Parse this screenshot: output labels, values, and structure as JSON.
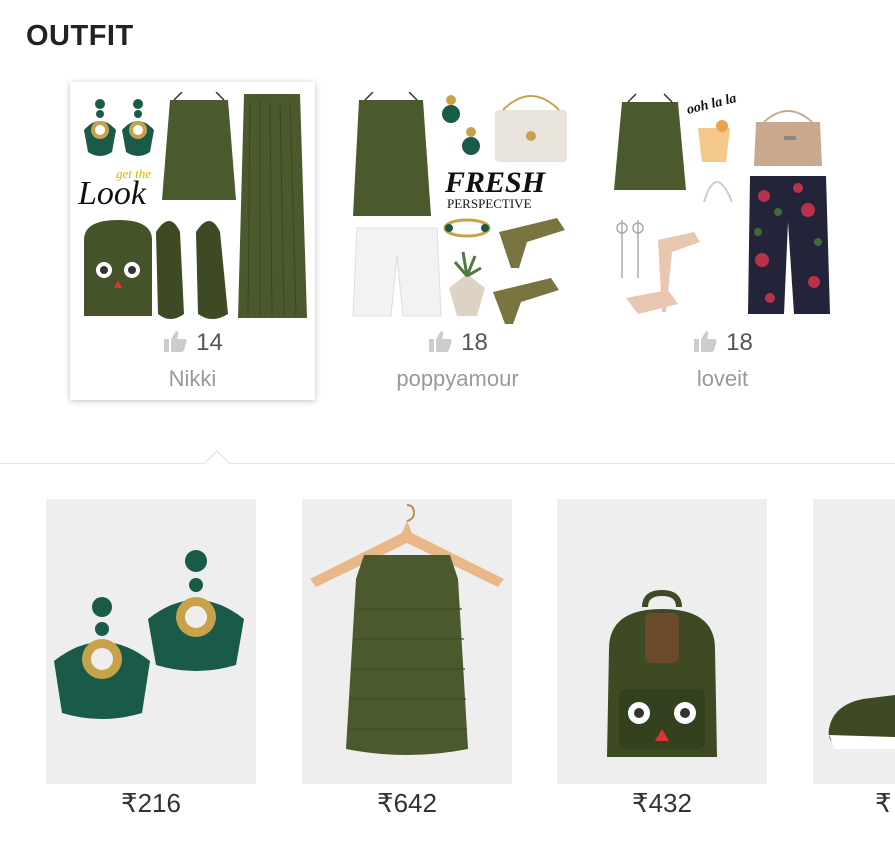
{
  "section": {
    "title": "OUTFIT"
  },
  "outfits": [
    {
      "likes": "14",
      "author": "Nikki",
      "overlay_text": "get the Look",
      "selected": true
    },
    {
      "likes": "18",
      "author": "poppyamour",
      "overlay_text": "FRESH PERSPECTIVE"
    },
    {
      "likes": "18",
      "author": "loveit",
      "overlay_text": "ooh la la"
    }
  ],
  "products": [
    {
      "price": "₹216",
      "icon": "earrings-icon"
    },
    {
      "price": "₹642",
      "icon": "top-on-hanger-icon"
    },
    {
      "price": "₹432",
      "icon": "backpack-icon"
    },
    {
      "price": "₹",
      "icon": "sneaker-icon"
    }
  ],
  "colors": {
    "olive": "#4a5a2c",
    "teal": "#1a5a48",
    "gold": "#c8a24a",
    "muted_text": "#999999"
  }
}
